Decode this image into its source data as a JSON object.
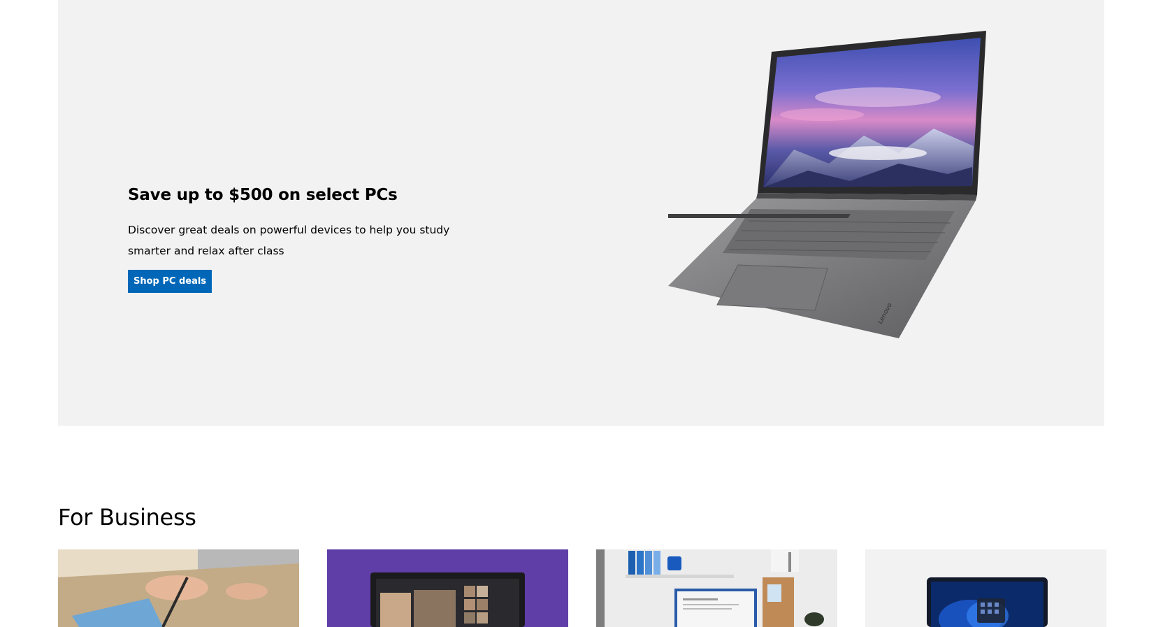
{
  "hero": {
    "title": "Save up to $500 on select PCs",
    "description": "Discover great deals on powerful devices to help you study smarter and relax after class",
    "cta_label": "Shop PC deals",
    "image": "lenovo-laptop-image",
    "laptop_brand": "Lenovo"
  },
  "business": {
    "title": "For Business",
    "cards": [
      {
        "image": "tablet-pen-signing-image"
      },
      {
        "image": "teams-video-call-laptop-image"
      },
      {
        "image": "desk-word-document-image"
      },
      {
        "image": "windows-11-laptop-image"
      }
    ]
  },
  "colors": {
    "accent": "#0067b8",
    "hero_background": "#f2f2f2",
    "teams_purple": "#5b3fa7"
  }
}
